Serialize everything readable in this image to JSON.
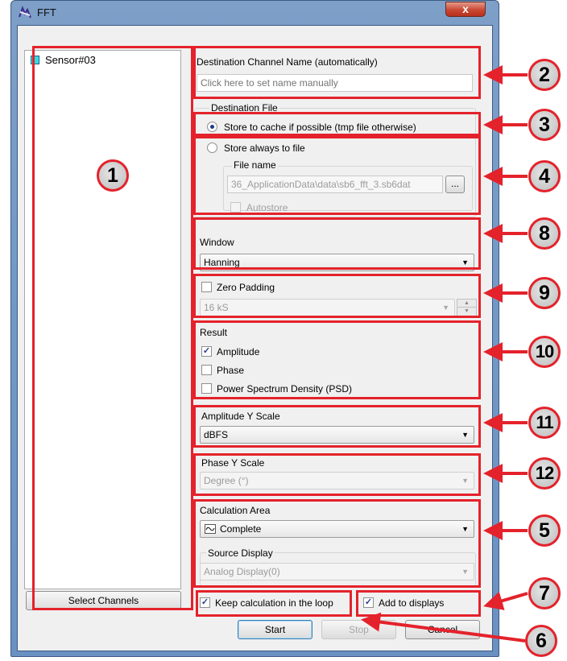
{
  "window": {
    "title": "FFT",
    "close_glyph": "x",
    "app_icon": "fft-app-icon"
  },
  "channels": {
    "items": [
      {
        "label": "Sensor#03",
        "color": "#29e0e6"
      }
    ],
    "select_button": "Select Channels"
  },
  "destination_channel": {
    "label": "Destination Channel Name (automatically)",
    "placeholder": "Click here to set name manually"
  },
  "destination_file": {
    "label": "Destination File",
    "option_cache": "Store to cache if possible (tmp file otherwise)",
    "option_file": "Store always to file",
    "file_name_label": "File name",
    "file_name_value": "36_ApplicationData\\data\\sb6_fft_3.sb6dat",
    "browse_label": "...",
    "autostore_label": "Autostore"
  },
  "window_fn": {
    "label": "Window",
    "value": "Hanning"
  },
  "zero_padding": {
    "label": "Zero Padding",
    "value": "16 kS"
  },
  "result": {
    "label": "Result",
    "amplitude": "Amplitude",
    "phase": "Phase",
    "psd": "Power Spectrum Density (PSD)",
    "check_glyph": "✓"
  },
  "amplitude_scale": {
    "label": "Amplitude Y Scale",
    "value": "dBFS"
  },
  "phase_scale": {
    "label": "Phase Y Scale",
    "value": "Degree (°)"
  },
  "calc_area": {
    "label": "Calculation Area",
    "value": "Complete",
    "source_label": "Source Display",
    "source_value": "Analog Display(0)"
  },
  "options": {
    "keep_loop": "Keep calculation in the loop",
    "add_displays": "Add to displays"
  },
  "buttons": {
    "start": "Start",
    "stop": "Stop",
    "cancel": "Cancel"
  },
  "callouts": [
    "1",
    "2",
    "3",
    "4",
    "8",
    "9",
    "10",
    "11",
    "12",
    "5",
    "7",
    "6"
  ],
  "colors": {
    "annotation_red": "#e4222b",
    "title_bar": "#6a91c2",
    "dialog_bg": "#f0f0f0"
  }
}
